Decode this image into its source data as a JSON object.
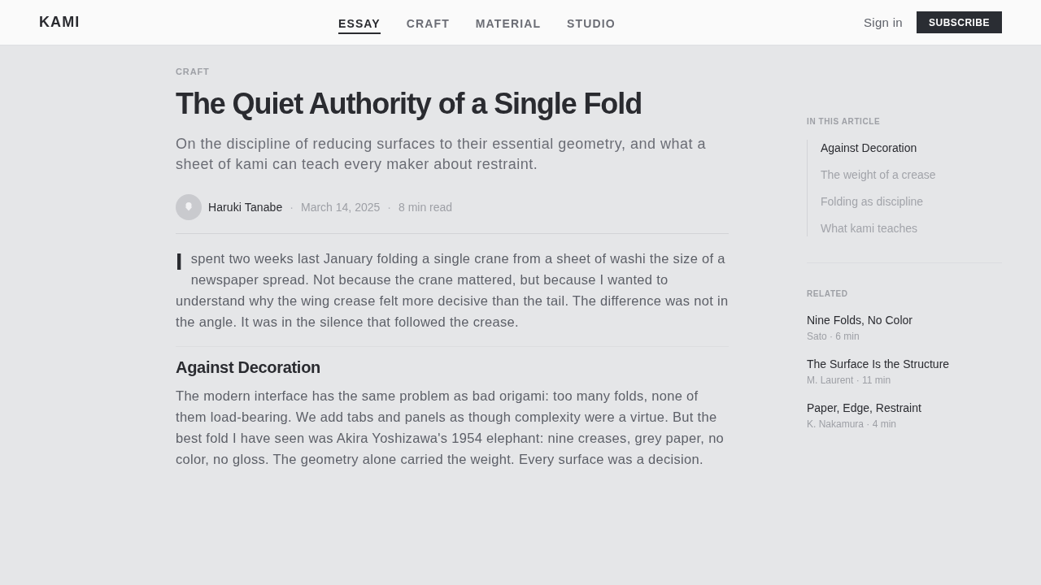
{
  "header": {
    "logo": "KAMI",
    "nav": [
      {
        "label": "ESSAY",
        "selected": true
      },
      {
        "label": "CRAFT",
        "selected": false
      },
      {
        "label": "MATERIAL",
        "selected": false
      },
      {
        "label": "STUDIO",
        "selected": false
      }
    ],
    "sign_in": "Sign in",
    "subscribe": "SUBSCRIBE"
  },
  "article": {
    "category": "CRAFT",
    "title": "The Quiet Authority of a Single Fold",
    "subtitle": "On the discipline of reducing surfaces to their essential geometry, and what a sheet of kami can teach every maker about restraint.",
    "byline": {
      "author": "Haruki Tanabe",
      "meta": [
        {
          "kind": "separator",
          "text": "·"
        },
        {
          "kind": "detail",
          "text": "March 14, 2025"
        },
        {
          "kind": "separator",
          "text": "·"
        },
        {
          "kind": "detail",
          "text": "8 min read"
        }
      ]
    },
    "intro": {
      "drop_cap": "I",
      "text": "spent two weeks last January folding a single crane from a sheet of washi the size of a newspaper spread. Not because the crane mattered, but because I wanted to understand why the wing crease felt more decisive than the tail. The difference was not in the angle. It was in the silence that followed the crease."
    },
    "sections": [
      {
        "heading": "Against Decoration",
        "paragraphs": [
          "The modern interface has the same problem as bad origami: too many folds, none of them load-bearing. We add tabs and panels as though complexity were a virtue. But the best fold I have seen was Akira Yoshizawa's 1954 elephant: nine creases, grey paper, no color, no gloss. The geometry alone carried the weight. Every surface was a decision."
        ]
      }
    ]
  },
  "sidebar": {
    "toc": {
      "title": "IN THIS ARTICLE",
      "items": [
        {
          "label": "Against Decoration",
          "selected": true
        },
        {
          "label": "The weight of a crease",
          "selected": false
        },
        {
          "label": "Folding as discipline",
          "selected": false
        },
        {
          "label": "What kami teaches",
          "selected": false
        }
      ]
    },
    "related": {
      "title": "RELATED",
      "items": [
        {
          "title": "Nine Folds, No Color",
          "meta": "Sato · 6 min"
        },
        {
          "title": "The Surface Is the Structure",
          "meta": "M. Laurent · 11 min"
        },
        {
          "title": "Paper, Edge, Restraint",
          "meta": "K. Nakamura · 4 min"
        }
      ]
    }
  }
}
